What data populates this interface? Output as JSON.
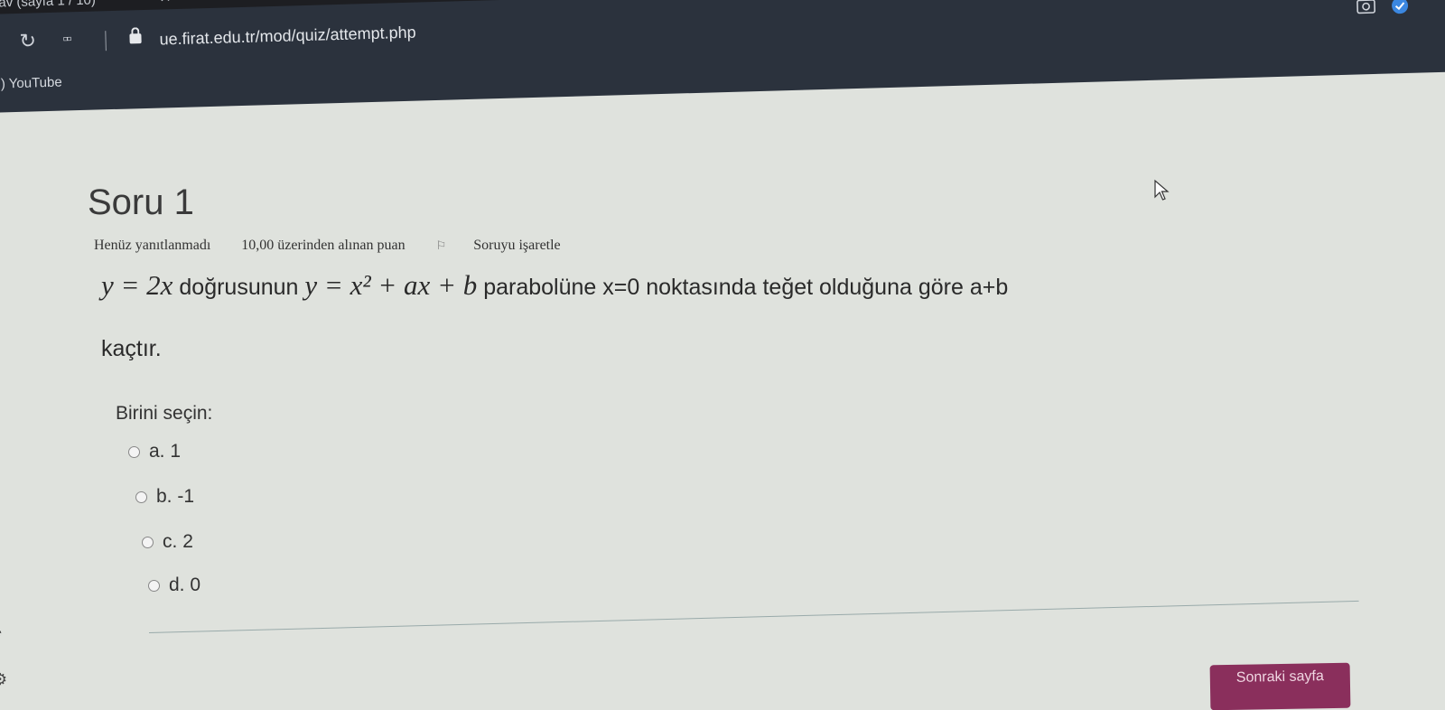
{
  "browser": {
    "tab_title": "av (sayfa 1 / 10)",
    "tab_close_icon": "close-icon",
    "new_tab_icon": "plus-icon",
    "url": "ue.firat.edu.tr/mod/quiz/attempt.php",
    "bookmark": ") YouTube"
  },
  "question": {
    "title": "Soru 1",
    "status": "Henüz yanıtlanmadı",
    "points": "10,00 üzerinden alınan puan",
    "flag_label": "Soruyu işaretle",
    "math1": "y = 2x",
    "text1": "doğrusunun",
    "math2": "y = x² + ax + b",
    "text2": "parabolüne x=0 noktasında teğet olduğuna göre a+b",
    "text3": "kaçtır.",
    "select_label": "Birini seçin:",
    "options": [
      {
        "letter": "a.",
        "value": "1"
      },
      {
        "letter": "b.",
        "value": "-1"
      },
      {
        "letter": "c.",
        "value": "2"
      },
      {
        "letter": "d.",
        "value": "0"
      }
    ]
  },
  "footer": {
    "next_button": "Sonraki sayfa"
  }
}
